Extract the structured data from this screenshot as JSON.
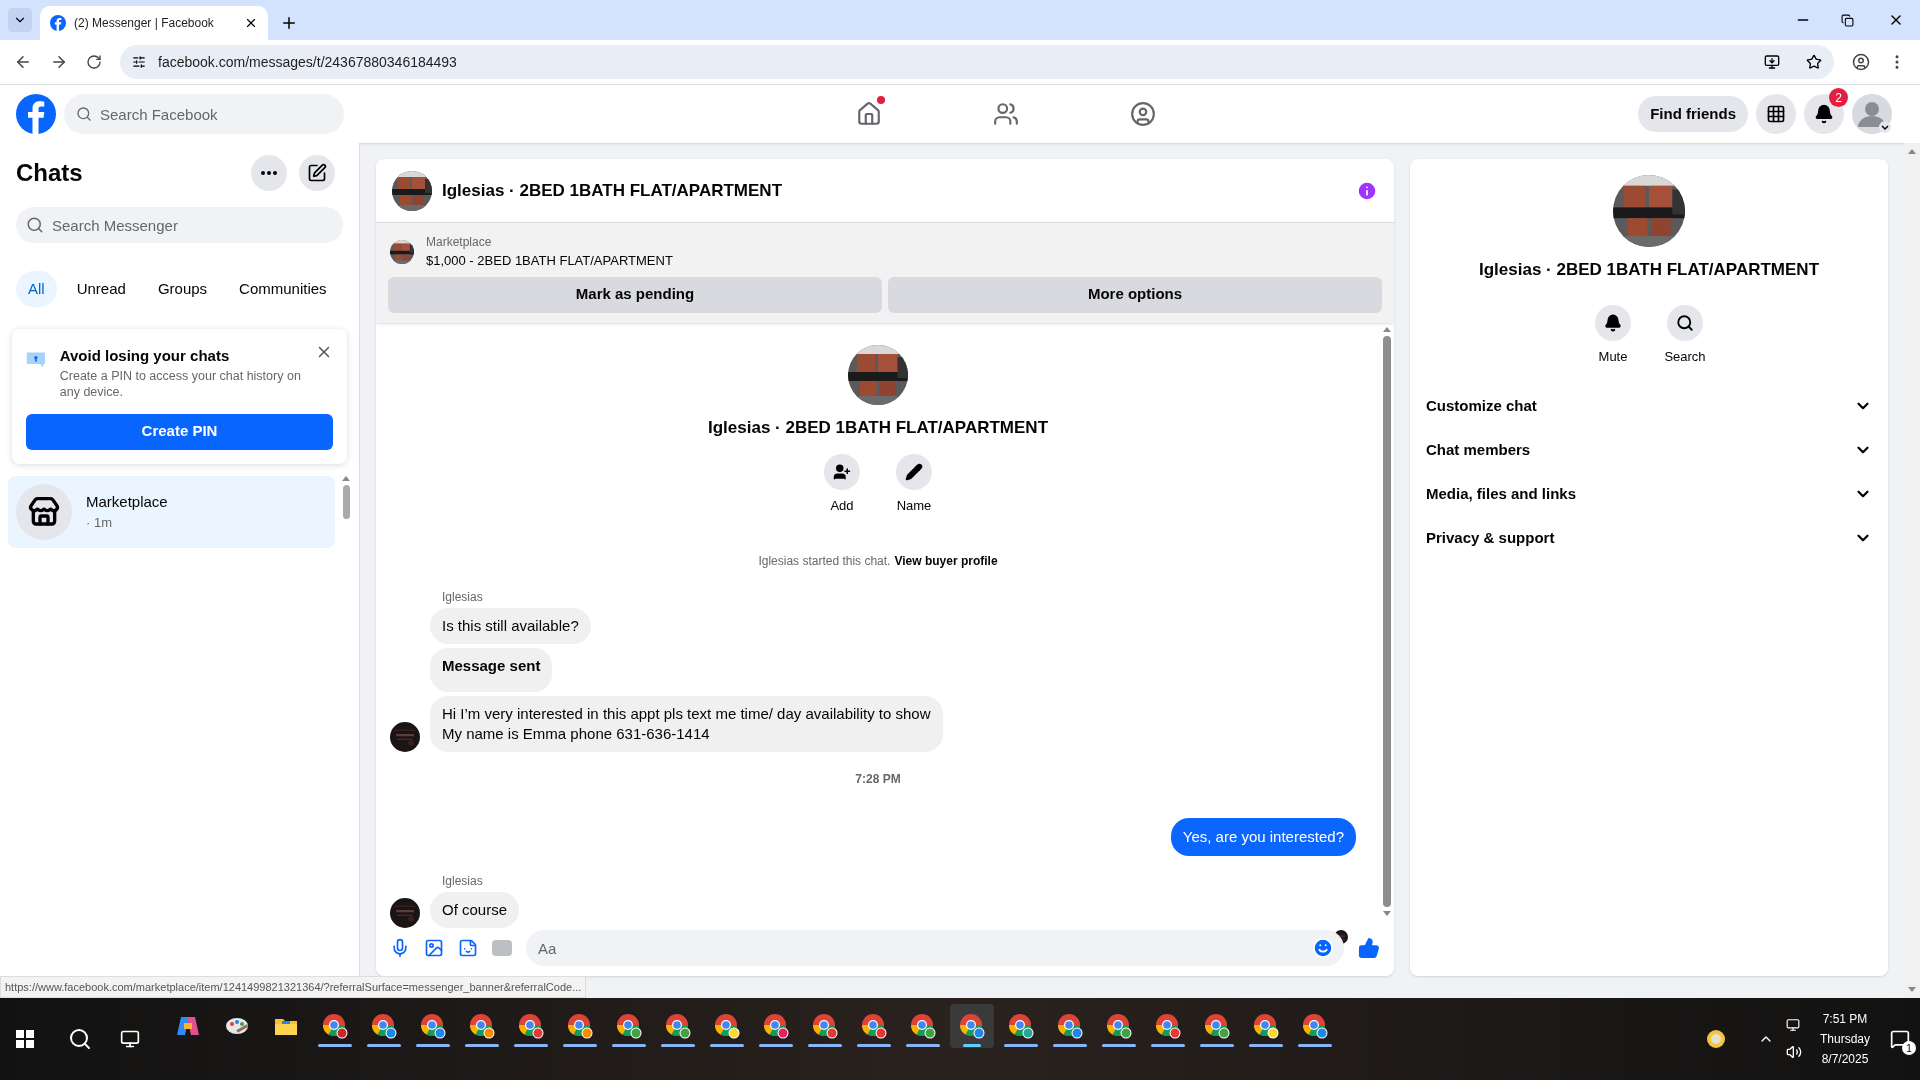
{
  "browser": {
    "tab_title": "(2) Messenger | Facebook",
    "url": "facebook.com/messages/t/24367880346184493"
  },
  "topbar": {
    "search_placeholder": "Search Facebook",
    "nav": [
      {
        "kind": "home",
        "dot": true
      },
      {
        "kind": "friends",
        "dot": false
      },
      {
        "kind": "groups",
        "dot": false
      }
    ],
    "find_friends": "Find friends",
    "notifications_count": "2"
  },
  "sidebar": {
    "title": "Chats",
    "search_placeholder": "Search Messenger",
    "filters": [
      {
        "label": "All",
        "selected": true
      },
      {
        "label": "Unread",
        "selected": false
      },
      {
        "label": "Groups",
        "selected": false
      },
      {
        "label": "Communities",
        "selected": false
      }
    ],
    "pin_card": {
      "title": "Avoid losing your chats",
      "text": "Create a PIN to access your chat history on any device.",
      "button": "Create PIN"
    },
    "chats": [
      {
        "name": "Marketplace",
        "time": "· 1m",
        "selected": true
      }
    ]
  },
  "conversation": {
    "title": "Iglesias · 2BED 1BATH FLAT/APARTMENT",
    "listing": {
      "label": "Marketplace",
      "item": "$1,000 - 2BED 1BATH FLAT/APARTMENT",
      "buttons": [
        "Mark as pending",
        "More options"
      ]
    },
    "intro": {
      "title": "Iglesias · 2BED 1BATH FLAT/APARTMENT",
      "actions": [
        {
          "kind": "add",
          "label": "Add"
        },
        {
          "kind": "name",
          "label": "Name"
        }
      ],
      "started": "Iglesias started this chat.",
      "link": "View buyer profile"
    },
    "messages": [
      {
        "kind": "incoming",
        "sender": "Iglesias",
        "text": "Is this still available?",
        "bold": false,
        "avatar": false
      },
      {
        "kind": "incoming",
        "text": "Message sent",
        "bold": true,
        "avatar": false
      },
      {
        "kind": "incoming",
        "text": "Hi I’m very interested in this appt pls text me time/ day availability to show\nMy name is Emma phone 631-636-1414",
        "bold": false,
        "avatar": true
      },
      {
        "kind": "time",
        "text": "7:28 PM"
      },
      {
        "kind": "outgoing",
        "text": "Yes, are you interested?",
        "bold": false
      },
      {
        "kind": "incoming",
        "sender": "Iglesias",
        "text": "Of course",
        "bold": false,
        "avatar": true
      }
    ],
    "composer_placeholder": "Aa"
  },
  "details": {
    "title": "Iglesias · 2BED 1BATH FLAT/APARTMENT",
    "actions": [
      {
        "kind": "mute",
        "label": "Mute"
      },
      {
        "kind": "search",
        "label": "Search"
      }
    ],
    "sections": [
      {
        "label": "Customize chat",
        "expanded": false
      },
      {
        "label": "Chat members",
        "expanded": false
      },
      {
        "label": "Media, files and links",
        "expanded": false
      },
      {
        "label": "Privacy & support",
        "expanded": false
      }
    ]
  },
  "status_url": "https://www.facebook.com/marketplace/item/1241499821321364/?referralSurface=messenger_banner&referralCode...",
  "taskbar": {
    "apps": [
      {
        "kind": "copilot",
        "selected": false
      },
      {
        "kind": "paint",
        "selected": false
      },
      {
        "kind": "folder",
        "selected": false
      },
      {
        "kind": "browser",
        "color": "#c62828",
        "selected": false
      },
      {
        "kind": "browser",
        "color": "#1e88e5",
        "selected": false
      },
      {
        "kind": "browser",
        "color": "#1e88e5",
        "selected": false
      },
      {
        "kind": "browser",
        "color": "#fb8c00",
        "selected": false
      },
      {
        "kind": "browser",
        "color": "#e53935",
        "selected": false
      },
      {
        "kind": "browser",
        "color": "#fb8c00",
        "selected": false
      },
      {
        "kind": "browser",
        "color": "#43a047",
        "selected": false
      },
      {
        "kind": "browser",
        "color": "#43a047",
        "selected": false
      },
      {
        "kind": "browser",
        "color": "#fdd835",
        "selected": false
      },
      {
        "kind": "browser",
        "color": "#e91e63",
        "selected": false
      },
      {
        "kind": "browser",
        "color": "#e53935",
        "selected": false
      },
      {
        "kind": "browser",
        "color": "#e53935",
        "selected": false
      },
      {
        "kind": "browser",
        "color": "#43a047",
        "selected": false
      },
      {
        "kind": "browser",
        "color": "#1e88e5",
        "selected": true
      },
      {
        "kind": "browser",
        "color": "#26a69a",
        "selected": false
      },
      {
        "kind": "browser",
        "color": "#1e88e5",
        "selected": false
      },
      {
        "kind": "browser",
        "color": "#43a047",
        "selected": false
      },
      {
        "kind": "browser",
        "color": "#e53935",
        "selected": false
      },
      {
        "kind": "browser",
        "color": "#43a047",
        "selected": false
      },
      {
        "kind": "browser",
        "color": "#fdd835",
        "selected": false
      },
      {
        "kind": "browser",
        "color": "#1e88e5",
        "selected": false
      }
    ],
    "time": "7:51 PM",
    "day": "Thursday",
    "date": "8/7/2025",
    "notification_count": "1"
  }
}
